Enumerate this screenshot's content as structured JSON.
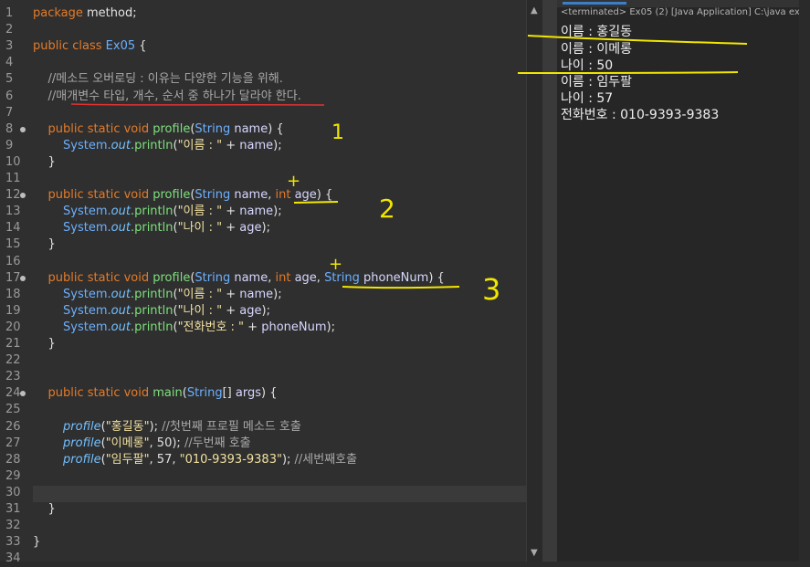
{
  "editor": {
    "lines": [
      {
        "n": "1",
        "parts": [
          [
            "kw",
            "package "
          ],
          [
            "plain",
            "method;"
          ]
        ]
      },
      {
        "n": "2",
        "parts": []
      },
      {
        "n": "3",
        "parts": [
          [
            "kw",
            "public class "
          ],
          [
            "cls",
            "Ex05"
          ],
          [
            "plain",
            " {"
          ]
        ]
      },
      {
        "n": "4",
        "parts": []
      },
      {
        "n": "5",
        "parts": [
          [
            "cm",
            "    //메소드 오버로딩 : 이유는 다양한 기능을 위해."
          ]
        ]
      },
      {
        "n": "6",
        "parts": [
          [
            "cm",
            "    //매개변수 타입, 개수, 순서 중 하나가 달라야 한다."
          ]
        ]
      },
      {
        "n": "7",
        "parts": []
      },
      {
        "n": "8",
        "bp": true,
        "parts": [
          [
            "kw",
            "    public static void "
          ],
          [
            "mth",
            "profile"
          ],
          [
            "plain",
            "("
          ],
          [
            "cls",
            "String "
          ],
          [
            "id",
            "name"
          ],
          [
            "plain",
            ") {"
          ]
        ]
      },
      {
        "n": "9",
        "parts": [
          [
            "cls",
            "        System."
          ],
          [
            "fld",
            "out"
          ],
          [
            "mth",
            ".println"
          ],
          [
            "plain",
            "("
          ],
          [
            "str",
            "\"이름 : \""
          ],
          [
            "plain",
            " + "
          ],
          [
            "id",
            "name"
          ],
          [
            "plain",
            ");"
          ]
        ]
      },
      {
        "n": "10",
        "parts": [
          [
            "plain",
            "    }"
          ]
        ]
      },
      {
        "n": "11",
        "parts": []
      },
      {
        "n": "12",
        "bp": true,
        "parts": [
          [
            "kw",
            "    public static void "
          ],
          [
            "mth",
            "profile"
          ],
          [
            "plain",
            "("
          ],
          [
            "cls",
            "String "
          ],
          [
            "id",
            "name"
          ],
          [
            "plain",
            ", "
          ],
          [
            "kw",
            "int "
          ],
          [
            "id",
            "age"
          ],
          [
            "plain",
            ") {"
          ]
        ]
      },
      {
        "n": "13",
        "parts": [
          [
            "cls",
            "        System."
          ],
          [
            "fld",
            "out"
          ],
          [
            "mth",
            ".println"
          ],
          [
            "plain",
            "("
          ],
          [
            "str",
            "\"이름 : \""
          ],
          [
            "plain",
            " + "
          ],
          [
            "id",
            "name"
          ],
          [
            "plain",
            ");"
          ]
        ]
      },
      {
        "n": "14",
        "parts": [
          [
            "cls",
            "        System."
          ],
          [
            "fld",
            "out"
          ],
          [
            "mth",
            ".println"
          ],
          [
            "plain",
            "("
          ],
          [
            "str",
            "\"나이 : \""
          ],
          [
            "plain",
            " + "
          ],
          [
            "id",
            "age"
          ],
          [
            "plain",
            ");"
          ]
        ]
      },
      {
        "n": "15",
        "parts": [
          [
            "plain",
            "    }"
          ]
        ]
      },
      {
        "n": "16",
        "parts": []
      },
      {
        "n": "17",
        "bp": true,
        "parts": [
          [
            "kw",
            "    public static void "
          ],
          [
            "mth",
            "profile"
          ],
          [
            "plain",
            "("
          ],
          [
            "cls",
            "String "
          ],
          [
            "id",
            "name"
          ],
          [
            "plain",
            ", "
          ],
          [
            "kw",
            "int "
          ],
          [
            "id",
            "age"
          ],
          [
            "plain",
            ", "
          ],
          [
            "cls",
            "String "
          ],
          [
            "id",
            "phoneNum"
          ],
          [
            "plain",
            ") {"
          ]
        ]
      },
      {
        "n": "18",
        "parts": [
          [
            "cls",
            "        System."
          ],
          [
            "fld",
            "out"
          ],
          [
            "mth",
            ".println"
          ],
          [
            "plain",
            "("
          ],
          [
            "str",
            "\"이름 : \""
          ],
          [
            "plain",
            " + "
          ],
          [
            "id",
            "name"
          ],
          [
            "plain",
            ");"
          ]
        ]
      },
      {
        "n": "19",
        "parts": [
          [
            "cls",
            "        System."
          ],
          [
            "fld",
            "out"
          ],
          [
            "mth",
            ".println"
          ],
          [
            "plain",
            "("
          ],
          [
            "str",
            "\"나이 : \""
          ],
          [
            "plain",
            " + "
          ],
          [
            "id",
            "age"
          ],
          [
            "plain",
            ");"
          ]
        ]
      },
      {
        "n": "20",
        "parts": [
          [
            "cls",
            "        System."
          ],
          [
            "fld",
            "out"
          ],
          [
            "mth",
            ".println"
          ],
          [
            "plain",
            "("
          ],
          [
            "str",
            "\"전화번호 : \""
          ],
          [
            "plain",
            " + "
          ],
          [
            "id",
            "phoneNum"
          ],
          [
            "plain",
            ");"
          ]
        ]
      },
      {
        "n": "21",
        "parts": [
          [
            "plain",
            "    }"
          ]
        ]
      },
      {
        "n": "22",
        "parts": []
      },
      {
        "n": "23",
        "parts": []
      },
      {
        "n": "24",
        "bp": true,
        "parts": [
          [
            "kw",
            "    public static void "
          ],
          [
            "mth",
            "main"
          ],
          [
            "plain",
            "("
          ],
          [
            "cls",
            "String"
          ],
          [
            "plain",
            "[] "
          ],
          [
            "id",
            "args"
          ],
          [
            "plain",
            ") {"
          ]
        ]
      },
      {
        "n": "25",
        "parts": []
      },
      {
        "n": "26",
        "parts": [
          [
            "fld",
            "        profile"
          ],
          [
            "plain",
            "("
          ],
          [
            "str",
            "\"홍길동\""
          ],
          [
            "plain",
            "); "
          ],
          [
            "cm",
            "//첫번째 프로필 메소드 호출"
          ]
        ]
      },
      {
        "n": "27",
        "parts": [
          [
            "fld",
            "        profile"
          ],
          [
            "plain",
            "("
          ],
          [
            "str",
            "\"이메롱\""
          ],
          [
            "plain",
            ", 50); "
          ],
          [
            "cm",
            "//두번째 호출"
          ]
        ]
      },
      {
        "n": "28",
        "parts": [
          [
            "fld",
            "        profile"
          ],
          [
            "plain",
            "("
          ],
          [
            "str",
            "\"임두팔\""
          ],
          [
            "plain",
            ", 57, "
          ],
          [
            "str",
            "\"010-9393-9383\""
          ],
          [
            "plain",
            "); "
          ],
          [
            "cm",
            "//세번째호출"
          ]
        ]
      },
      {
        "n": "29",
        "parts": []
      },
      {
        "n": "30",
        "parts": []
      },
      {
        "n": "31",
        "parts": [
          [
            "plain",
            "    }"
          ]
        ]
      },
      {
        "n": "32",
        "parts": []
      },
      {
        "n": "33",
        "parts": [
          [
            "plain",
            "}"
          ]
        ]
      },
      {
        "n": "34",
        "parts": []
      }
    ]
  },
  "console": {
    "header": "<terminated> Ex05 (2) [Java Application] C:\\java ex",
    "output": [
      "이름 : 홍길동",
      "이름 : 이메롱",
      "나이 : 50",
      "이름 : 임두팔",
      "나이 : 57",
      "전화번호 : 010-9393-9383"
    ]
  },
  "annotations": {
    "marks": [
      "1",
      "+",
      "2",
      "+",
      "3"
    ],
    "pen_color_yellow": "#f2e600",
    "pen_color_red": "#e23232"
  },
  "scrollbar": {
    "up": "▲",
    "down": "▼"
  }
}
